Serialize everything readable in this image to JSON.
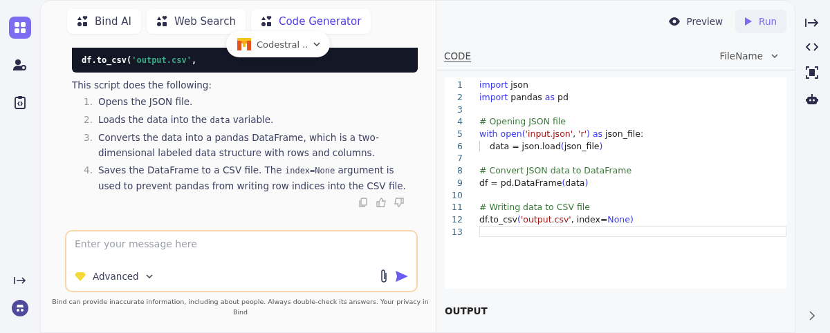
{
  "left_rail": {
    "items": [
      {
        "kind": "apps",
        "selected": true
      },
      {
        "kind": "user-settings",
        "selected": false
      },
      {
        "kind": "code-file",
        "selected": false
      }
    ]
  },
  "chat": {
    "tabs": [
      {
        "label": "Bind AI",
        "selected": false
      },
      {
        "label": "Web Search",
        "selected": false
      },
      {
        "label": "Code Generator",
        "selected": true
      }
    ],
    "model": "Codestral ..",
    "code_snippet": [
      {
        "text": "df.to_csv(",
        "kind": "plain"
      },
      {
        "text": "'output.csv'",
        "kind": "str"
      },
      {
        "text": ",",
        "kind": "plain"
      }
    ],
    "intro": "This script does the following:",
    "steps": [
      {
        "number": "1.",
        "parts": [
          {
            "text": "Opens the JSON file.",
            "code": false
          }
        ]
      },
      {
        "number": "2.",
        "parts": [
          {
            "text": "Loads the data into the ",
            "code": false
          },
          {
            "text": "data",
            "code": true
          },
          {
            "text": " variable.",
            "code": false
          }
        ]
      },
      {
        "number": "3.",
        "parts": [
          {
            "text": "Converts the data into a pandas DataFrame, which is a two-dimensional labeled data structure with rows and columns.",
            "code": false
          }
        ]
      },
      {
        "number": "4.",
        "parts": [
          {
            "text": "Saves the DataFrame to a CSV file. The ",
            "code": false
          },
          {
            "text": "index=None",
            "code": true
          },
          {
            "text": " argument is used to prevent pandas from writing row indices into the CSV file.",
            "code": false
          }
        ]
      }
    ],
    "input": {
      "placeholder": "Enter your message here"
    },
    "mode": "Advanced",
    "disclaimer": "Bind can provide inaccurate information, including about people. Always double-check its answers. Your privacy in Bind"
  },
  "editor": {
    "preview": "Preview",
    "run": "Run",
    "tab": "CODE",
    "file": "FileName",
    "lines": [
      {
        "number": "1",
        "tokens": [
          {
            "text": "import",
            "kind": "kw"
          },
          {
            "text": " json",
            "kind": "plain"
          }
        ]
      },
      {
        "number": "2",
        "tokens": [
          {
            "text": "import",
            "kind": "kw"
          },
          {
            "text": " pandas ",
            "kind": "plain"
          },
          {
            "text": "as",
            "kind": "kw"
          },
          {
            "text": " pd",
            "kind": "plain"
          }
        ]
      },
      {
        "number": "3"
      },
      {
        "number": "4",
        "tokens": [
          {
            "text": "# Opening JSON file",
            "kind": "comment"
          }
        ]
      },
      {
        "number": "5",
        "tokens": [
          {
            "text": "with open(",
            "kind": "kw"
          },
          {
            "text": "'input.json'",
            "kind": "str"
          },
          {
            "text": ", ",
            "kind": "plain"
          },
          {
            "text": "'r'",
            "kind": "str"
          },
          {
            "text": ") as",
            "kind": "kw"
          },
          {
            "text": " json_file:",
            "kind": "plain"
          }
        ]
      },
      {
        "number": "6",
        "indent": true,
        "tokens": [
          {
            "text": "data = json.load",
            "kind": "plain"
          },
          {
            "text": "(",
            "kind": "kw"
          },
          {
            "text": "json_file",
            "kind": "plain"
          },
          {
            "text": ")",
            "kind": "kw"
          }
        ]
      },
      {
        "number": "7"
      },
      {
        "number": "8",
        "tokens": [
          {
            "text": "# Convert JSON data to DataFrame",
            "kind": "comment"
          }
        ]
      },
      {
        "number": "9",
        "tokens": [
          {
            "text": "df = pd.DataFrame",
            "kind": "plain"
          },
          {
            "text": "(",
            "kind": "kw"
          },
          {
            "text": "data",
            "kind": "plain"
          },
          {
            "text": ")",
            "kind": "kw"
          }
        ]
      },
      {
        "number": "10"
      },
      {
        "number": "11",
        "tokens": [
          {
            "text": "# Writing data to CSV file",
            "kind": "comment"
          }
        ]
      },
      {
        "number": "12",
        "tokens": [
          {
            "text": "df.to_csv",
            "kind": "plain"
          },
          {
            "text": "(",
            "kind": "kw"
          },
          {
            "text": "'output.csv'",
            "kind": "str"
          },
          {
            "text": ", index=",
            "kind": "plain"
          },
          {
            "text": "None",
            "kind": "kw"
          },
          {
            "text": ")",
            "kind": "kw"
          }
        ]
      },
      {
        "number": "13",
        "current": true
      }
    ],
    "output": "OUTPUT"
  },
  "right_rail": {
    "items": [
      {
        "kind": "collapse"
      },
      {
        "kind": "code"
      },
      {
        "kind": "scan"
      },
      {
        "kind": "robot"
      }
    ]
  }
}
